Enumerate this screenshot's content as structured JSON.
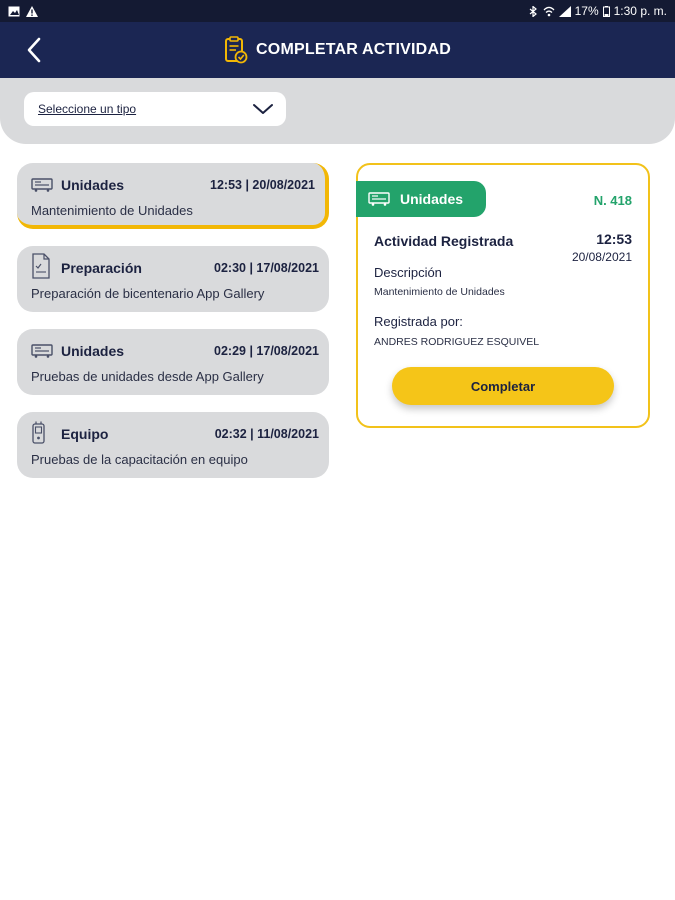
{
  "status_bar": {
    "time": "1:30 p. m.",
    "battery": "17%",
    "left_icons": [
      "image-icon",
      "warning-icon"
    ],
    "right_icons": [
      "bluetooth-icon",
      "wifi-icon",
      "signal-icon",
      "battery-icon"
    ]
  },
  "header": {
    "title": "COMPLETAR ACTIVIDAD",
    "icon": "clipboard-check-icon",
    "back_icon": "chevron-left-icon"
  },
  "filter": {
    "placeholder": "Seleccione un tipo"
  },
  "activities": [
    {
      "type": "Unidades",
      "time": "12:53 | 20/08/2021",
      "description": "Mantenimiento de Unidades",
      "icon": "truck-icon",
      "selected": true
    },
    {
      "type": "Preparación",
      "time": "02:30 | 17/08/2021",
      "description": "Preparación de bicentenario App Gallery",
      "icon": "document-icon",
      "selected": false
    },
    {
      "type": "Unidades",
      "time": "02:29 | 17/08/2021",
      "description": "Pruebas de unidades desde App Gallery",
      "icon": "truck-icon",
      "selected": false
    },
    {
      "type": "Equipo",
      "time": "02:32 | 11/08/2021",
      "description": "Pruebas de la capacitación en equipo",
      "icon": "equipment-icon",
      "selected": false
    }
  ],
  "detail": {
    "badge": "Unidades",
    "number": "N. 418",
    "registered_label": "Actividad Registrada",
    "time": "12:53",
    "date": "20/08/2021",
    "description_label": "Descripción",
    "description": "Mantenimiento de Unidades",
    "registered_by_label": "Registrada por:",
    "registered_by": "ANDRES RODRIGUEZ ESQUIVEL",
    "complete_button": "Completar"
  },
  "colors": {
    "header": "#1b2653",
    "accent_yellow": "#f2c21a",
    "badge_green": "#23a36b",
    "card_gray": "#d9dadc"
  }
}
